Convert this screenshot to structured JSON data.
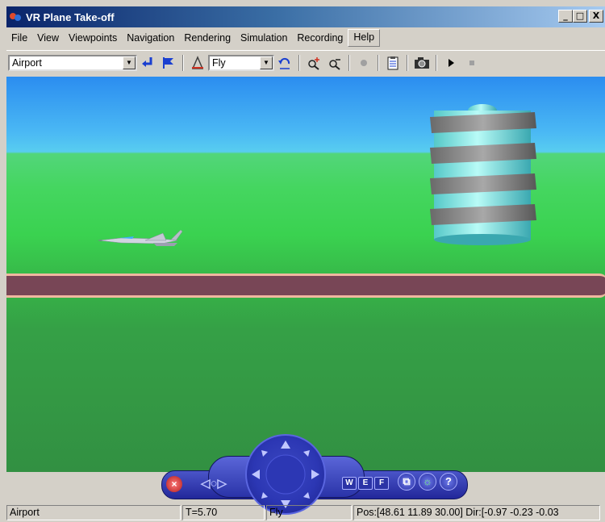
{
  "window": {
    "title": "VR Plane Take-off",
    "minimize_glyph": "_",
    "maximize_glyph": "□",
    "close_glyph": "X"
  },
  "menu": {
    "items": [
      "File",
      "View",
      "Viewpoints",
      "Navigation",
      "Rendering",
      "Simulation",
      "Recording",
      "Help"
    ],
    "active": "Help"
  },
  "toolbar": {
    "viewpoint_select": "Airport",
    "navigation_mode_select": "Fly",
    "icons": [
      "return-to-viewpoint-icon",
      "create-viewpoint-icon",
      "straighten-up-icon",
      "undo-move-icon",
      "zoom-in-icon",
      "zoom-out-icon",
      "record-icon",
      "recording-params-icon",
      "snapshot-icon",
      "play-icon",
      "stop-icon"
    ]
  },
  "navigation_panel": {
    "close": "×",
    "left_arrows": "◁○▷",
    "keys": [
      "W",
      "E",
      "F"
    ],
    "round_buttons": [
      "⧉",
      "☼",
      "?"
    ]
  },
  "status": {
    "viewpoint": "Airport",
    "time": "T=5.70",
    "mode": "Fly",
    "position": "Pos:[48.61 11.89 30.00] Dir:[-0.97 -0.23 -0.03"
  },
  "colors": {
    "sky_top": "#2b8df0",
    "sky_bottom": "#58cdf0",
    "grass": "#3ad250",
    "runway": "#784656",
    "runway_edge": "#f0b8a0",
    "tower": "#7fe8e0",
    "nav_panel": "#2b33a6"
  }
}
